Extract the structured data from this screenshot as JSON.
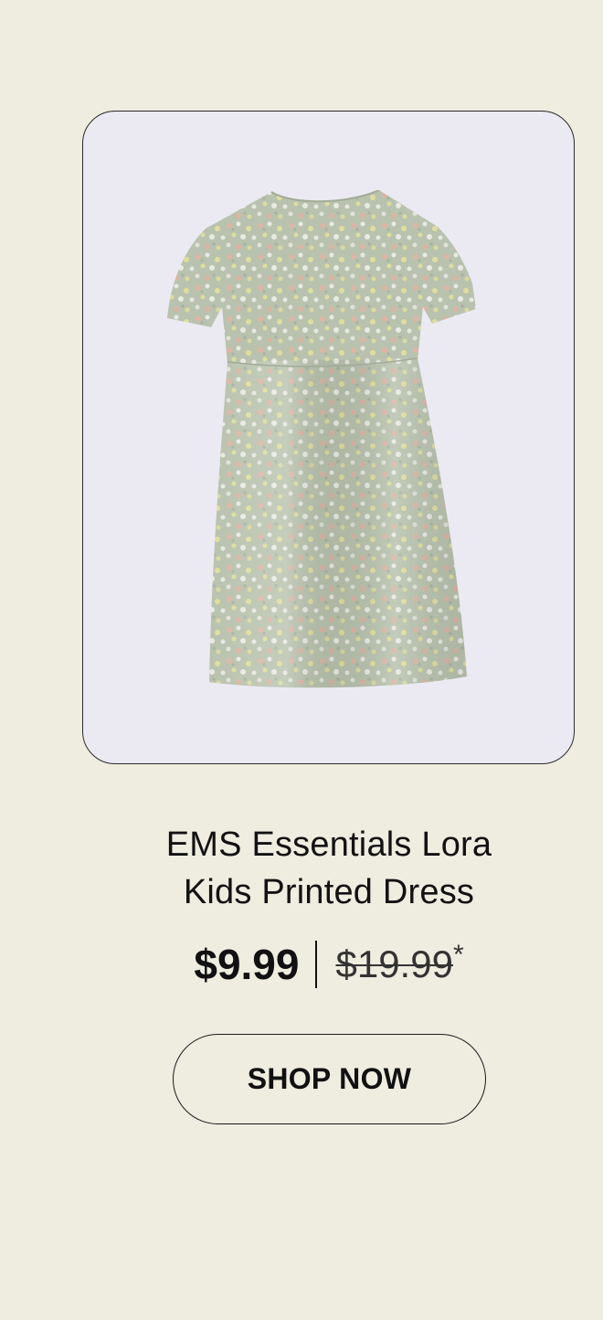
{
  "product": {
    "image_alt": "girl's short-sleeve floral printed dress",
    "title_line1": "EMS Essentials Lora",
    "title_line2": "Kids Printed Dress",
    "sale_price": "$9.99",
    "original_price": "$19.99",
    "price_footnote_marker": "*"
  },
  "cta": {
    "label": "SHOP NOW"
  },
  "colors": {
    "page_background": "#efece0",
    "card_background": "#ebeaf2",
    "dress_base": "#b9c2ae",
    "print_pink": "#e8b0a2",
    "print_yellow": "#e9e59a",
    "print_white": "#f1f1ec"
  }
}
